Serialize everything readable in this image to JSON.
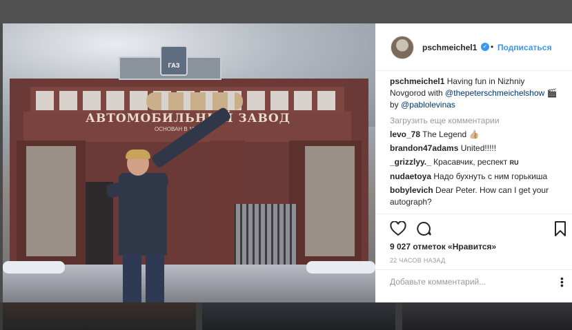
{
  "post": {
    "photo_text": {
      "sign": "АВТОМОБИЛЬНЫЙ ЗАВОД",
      "founded": "ОСНОВАН В 1932",
      "emblem": "ГАЗ"
    },
    "author": {
      "username": "pschmeichel1",
      "verified_label": "✓",
      "separator": "•",
      "follow_label": "Подписаться"
    },
    "caption": {
      "username": "pschmeichel1",
      "text_1": " Having fun in Nizhniy Novgorod with ",
      "mention_1": "@thepeterschmeichelshow",
      "emoji": " 🎬",
      "text_2": " by ",
      "mention_2": "@pablolevinas"
    },
    "load_more": "Загрузить еще комментарии",
    "comments": [
      {
        "username": "levo_78",
        "text": " The Legend 👍🏼"
      },
      {
        "username": "brandon47adams",
        "text": " United!!!!!"
      },
      {
        "username": "_grizzlyy._",
        "text": " Красавчик, респект ",
        "flag": "RU"
      },
      {
        "username": "nudaetoya",
        "text": " Надо бухнуть с ним горькиша"
      },
      {
        "username": "bobylevich",
        "text": " Dear Peter. How can I get your autograph?"
      }
    ],
    "likes": "9 027 отметок «Нравится»",
    "timestamp": "22 ЧАСОВ НАЗАД",
    "add_comment_placeholder": "Добавьте комментарий...",
    "icons": {
      "like": "heart-icon",
      "comment": "comment-icon",
      "save": "bookmark-icon",
      "more": "more-options-icon"
    }
  }
}
